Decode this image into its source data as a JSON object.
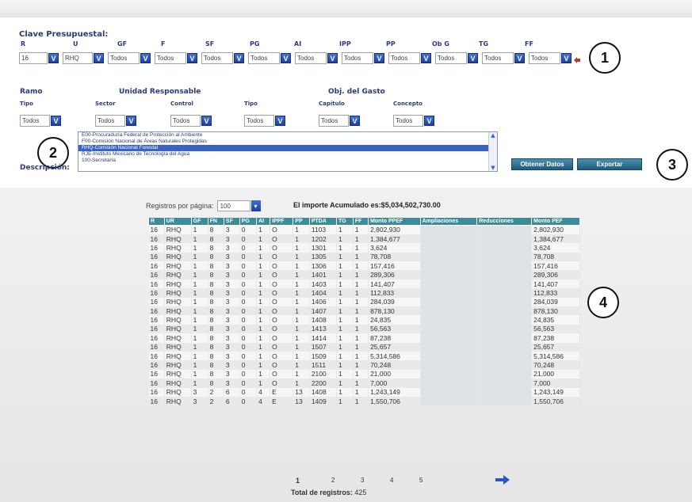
{
  "clave": {
    "title": "Clave Presupuestal:",
    "labels": [
      "R",
      "U",
      "GF",
      "F",
      "SF",
      "PG",
      "AI",
      "IPP",
      "PP",
      "Ob G",
      "TG",
      "FF"
    ],
    "values": {
      "r": "16",
      "u": "RHQ",
      "todos": "Todos"
    }
  },
  "ramo": {
    "title": "Ramo",
    "tipo_label": "Tipo",
    "tipo_value": "Todos"
  },
  "unidad": {
    "title": "Unidad Responsable",
    "sector_label": "Sector",
    "sector_value": "Todos",
    "control_label": "Control",
    "control_value": "Todos",
    "tipo_label": "Tipo",
    "tipo_value": "Todos"
  },
  "gasto": {
    "title": "Obj. del Gasto",
    "capitulo_label": "Capítulo",
    "capitulo_value": "Todos",
    "concepto_label": "Concepto",
    "concepto_value": "Todos"
  },
  "description": {
    "label": "Descripción:",
    "items": [
      "E00-Procuraduría Federal de Protección al Ambiente",
      "F00-Comisión Nacional de Áreas Naturales Protegidas",
      "RHQ-Comisión Nacional Forestal",
      "RJE-Instituto Mexicano de Tecnología del Agua",
      "100-Secretaría"
    ],
    "selected_index": 2
  },
  "buttons": {
    "obtener": "Obtener Datos",
    "exportar": "Exportar"
  },
  "callouts": [
    "1",
    "2",
    "3",
    "4"
  ],
  "results": {
    "rpp_label": "Registros por página:",
    "rpp_value": "100",
    "importe": "El importe Acumulado es:$5,034,502,730.00",
    "columns": [
      "R",
      "UR",
      "GF",
      "FN",
      "SF",
      "PG",
      "AI",
      "IPPF",
      "PP",
      "PTDA",
      "TG",
      "FF",
      "Monto PPEF",
      "Ampliaciones",
      "Reducciones",
      "Monto PEF"
    ],
    "rows": [
      [
        "16",
        "RHQ",
        "1",
        "8",
        "3",
        "0",
        "1",
        "O",
        "1",
        "1103",
        "1",
        "1",
        "2,802,930",
        "",
        "",
        "2,802,930"
      ],
      [
        "16",
        "RHQ",
        "1",
        "8",
        "3",
        "0",
        "1",
        "O",
        "1",
        "1202",
        "1",
        "1",
        "1,384,677",
        "",
        "",
        "1,384,677"
      ],
      [
        "16",
        "RHQ",
        "1",
        "8",
        "3",
        "0",
        "1",
        "O",
        "1",
        "1301",
        "1",
        "1",
        "3,624",
        "",
        "",
        "3,624"
      ],
      [
        "16",
        "RHQ",
        "1",
        "8",
        "3",
        "0",
        "1",
        "O",
        "1",
        "1305",
        "1",
        "1",
        "78,708",
        "",
        "",
        "78,708"
      ],
      [
        "16",
        "RHQ",
        "1",
        "8",
        "3",
        "0",
        "1",
        "O",
        "1",
        "1306",
        "1",
        "1",
        "157,416",
        "",
        "",
        "157,416"
      ],
      [
        "16",
        "RHQ",
        "1",
        "8",
        "3",
        "0",
        "1",
        "O",
        "1",
        "1401",
        "1",
        "1",
        "289,306",
        "",
        "",
        "289,306"
      ],
      [
        "16",
        "RHQ",
        "1",
        "8",
        "3",
        "0",
        "1",
        "O",
        "1",
        "1403",
        "1",
        "1",
        "141,407",
        "",
        "",
        "141,407"
      ],
      [
        "16",
        "RHQ",
        "1",
        "8",
        "3",
        "0",
        "1",
        "O",
        "1",
        "1404",
        "1",
        "1",
        "112,833",
        "",
        "",
        "112,833"
      ],
      [
        "16",
        "RHQ",
        "1",
        "8",
        "3",
        "0",
        "1",
        "O",
        "1",
        "1406",
        "1",
        "1",
        "284,039",
        "",
        "",
        "284,039"
      ],
      [
        "16",
        "RHQ",
        "1",
        "8",
        "3",
        "0",
        "1",
        "O",
        "1",
        "1407",
        "1",
        "1",
        "878,130",
        "",
        "",
        "878,130"
      ],
      [
        "16",
        "RHQ",
        "1",
        "8",
        "3",
        "0",
        "1",
        "O",
        "1",
        "1408",
        "1",
        "1",
        "24,835",
        "",
        "",
        "24,835"
      ],
      [
        "16",
        "RHQ",
        "1",
        "8",
        "3",
        "0",
        "1",
        "O",
        "1",
        "1413",
        "1",
        "1",
        "56,563",
        "",
        "",
        "56,563"
      ],
      [
        "16",
        "RHQ",
        "1",
        "8",
        "3",
        "0",
        "1",
        "O",
        "1",
        "1414",
        "1",
        "1",
        "87,238",
        "",
        "",
        "87,238"
      ],
      [
        "16",
        "RHQ",
        "1",
        "8",
        "3",
        "0",
        "1",
        "O",
        "1",
        "1507",
        "1",
        "1",
        "25,657",
        "",
        "",
        "25,657"
      ],
      [
        "16",
        "RHQ",
        "1",
        "8",
        "3",
        "0",
        "1",
        "O",
        "1",
        "1509",
        "1",
        "1",
        "5,314,586",
        "",
        "",
        "5,314,586"
      ],
      [
        "16",
        "RHQ",
        "1",
        "8",
        "3",
        "0",
        "1",
        "O",
        "1",
        "1511",
        "1",
        "1",
        "70,248",
        "",
        "",
        "70,248"
      ],
      [
        "16",
        "RHQ",
        "1",
        "8",
        "3",
        "0",
        "1",
        "O",
        "1",
        "2100",
        "1",
        "1",
        "21,000",
        "",
        "",
        "21,000"
      ],
      [
        "16",
        "RHQ",
        "1",
        "8",
        "3",
        "0",
        "1",
        "O",
        "1",
        "2200",
        "1",
        "1",
        "7,000",
        "",
        "",
        "7,000"
      ],
      [
        "16",
        "RHQ",
        "3",
        "2",
        "6",
        "0",
        "4",
        "E",
        "13",
        "1408",
        "1",
        "1",
        "1,243,149",
        "",
        "",
        "1,243,149"
      ],
      [
        "16",
        "RHQ",
        "3",
        "2",
        "6",
        "0",
        "4",
        "E",
        "13",
        "1409",
        "1",
        "1",
        "1,550,706",
        "",
        "",
        "1,550,706"
      ]
    ],
    "pages": [
      "1",
      "2",
      "3",
      "4",
      "5"
    ],
    "current_page": "1",
    "total_label": "Total de registros:",
    "total_value": "425"
  }
}
